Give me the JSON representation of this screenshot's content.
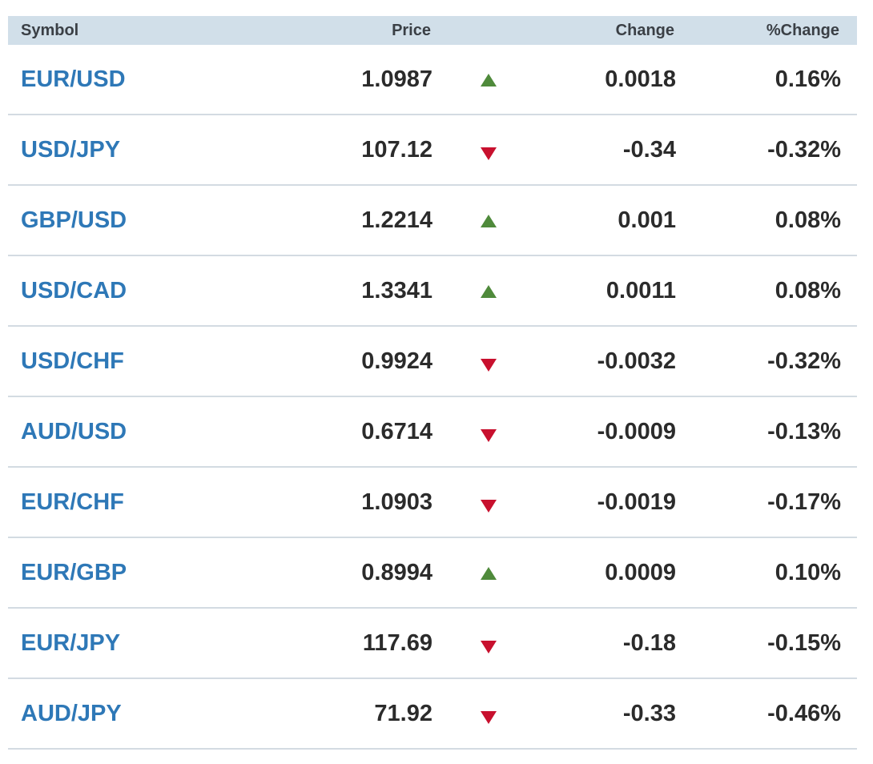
{
  "header": {
    "symbol": "Symbol",
    "price": "Price",
    "change": "Change",
    "pct_change": "%Change"
  },
  "colors": {
    "header_bg": "#d1dfe9",
    "symbol_link": "#2e78b7",
    "up": "#4f8a3b",
    "down": "#c8102e"
  },
  "rows": [
    {
      "symbol": "EUR/USD",
      "price": "1.0987",
      "direction": "up",
      "change": "0.0018",
      "pct": "0.16%"
    },
    {
      "symbol": "USD/JPY",
      "price": "107.12",
      "direction": "down",
      "change": "-0.34",
      "pct": "-0.32%"
    },
    {
      "symbol": "GBP/USD",
      "price": "1.2214",
      "direction": "up",
      "change": "0.001",
      "pct": "0.08%"
    },
    {
      "symbol": "USD/CAD",
      "price": "1.3341",
      "direction": "up",
      "change": "0.0011",
      "pct": "0.08%"
    },
    {
      "symbol": "USD/CHF",
      "price": "0.9924",
      "direction": "down",
      "change": "-0.0032",
      "pct": "-0.32%"
    },
    {
      "symbol": "AUD/USD",
      "price": "0.6714",
      "direction": "down",
      "change": "-0.0009",
      "pct": "-0.13%"
    },
    {
      "symbol": "EUR/CHF",
      "price": "1.0903",
      "direction": "down",
      "change": "-0.0019",
      "pct": "-0.17%"
    },
    {
      "symbol": "EUR/GBP",
      "price": "0.8994",
      "direction": "up",
      "change": "0.0009",
      "pct": "0.10%"
    },
    {
      "symbol": "EUR/JPY",
      "price": "117.69",
      "direction": "down",
      "change": "-0.18",
      "pct": "-0.15%"
    },
    {
      "symbol": "AUD/JPY",
      "price": "71.92",
      "direction": "down",
      "change": "-0.33",
      "pct": "-0.46%"
    }
  ]
}
